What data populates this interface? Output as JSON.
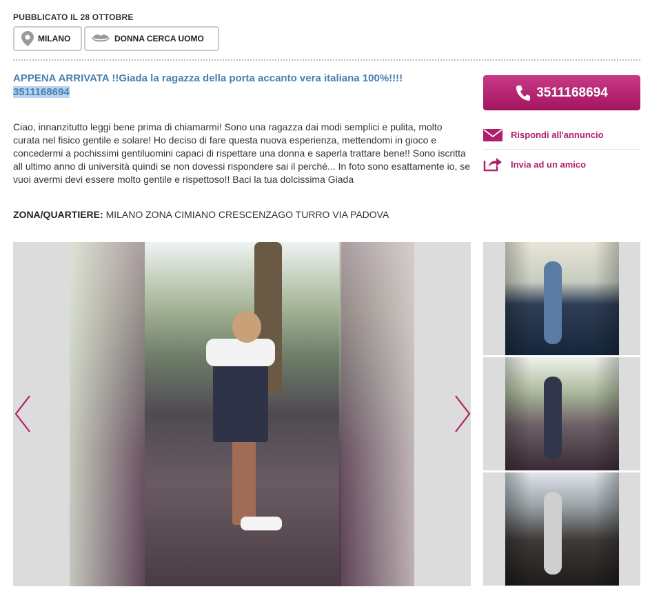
{
  "header": {
    "published": "PUBBLICATO IL 28 OTTOBRE",
    "tags": {
      "city": "MILANO",
      "category": "DONNA CERCA UOMO"
    }
  },
  "ad": {
    "title_main": "APPENA ARRIVATA !!Giada la ragazza della porta accanto vera italiana 100%!!!!",
    "title_phone": "3511168694",
    "description": "Ciao, innanzitutto leggi bene prima di chiamarmi! Sono una ragazza dai modi semplici e pulita, molto curata nel fisico gentile e solare! Ho deciso di fare questa nuova esperienza, mettendomi in gioco e concedermi a pochissimi gentiluomini capaci di rispettare una donna e saperla trattare bene!! Sono iscritta all ultimo anno di università quindi se non dovessi rispondere sai il perché... In foto sono esattamente io, se vuoi avermi devi essere molto gentile e rispettoso!! Baci la tua dolcissima Giada",
    "zone_label": "ZONA/QUARTIERE:",
    "zone_value": "MILANO ZONA CIMIANO CRESCENZAGO TURRO VIA PADOVA"
  },
  "sidebar": {
    "call_button": "3511168694",
    "reply_label": "Rispondi all'annuncio",
    "share_label": "Invia ad un amico"
  },
  "gallery": {
    "icons": {
      "prev": "chevron-left-icon",
      "next": "chevron-right-icon"
    },
    "colors": {
      "accent": "#b01f6a",
      "title": "#4a7fad"
    }
  }
}
